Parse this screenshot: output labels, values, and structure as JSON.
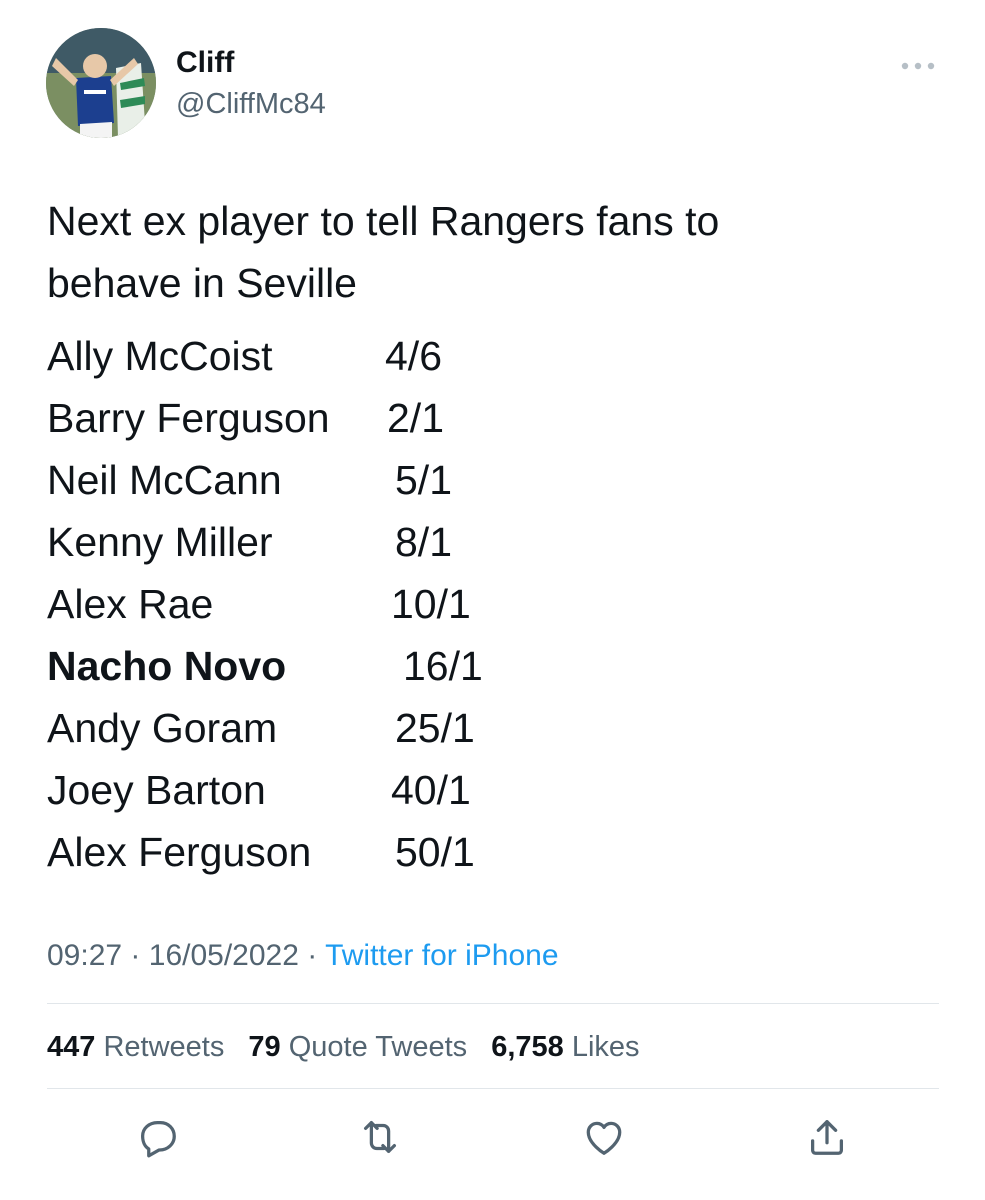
{
  "author": {
    "display_name": "Cliff",
    "handle": "@CliffMc84",
    "avatar_icon": "avatar-photo"
  },
  "tweet": {
    "text_line_1": "Next ex player to tell Rangers fans to",
    "text_line_2": "behave in Seville",
    "odds": [
      {
        "name": "Ally McCoist",
        "odds": "4/6",
        "bold": false
      },
      {
        "name": "Barry Ferguson",
        "odds": "2/1",
        "bold": false
      },
      {
        "name": "Neil McCann",
        "odds": "5/1",
        "bold": false
      },
      {
        "name": "Kenny Miller",
        "odds": "8/1",
        "bold": false
      },
      {
        "name": "Alex Rae",
        "odds": "10/1",
        "bold": false
      },
      {
        "name": "Nacho Novo",
        "odds": "16/1",
        "bold": true
      },
      {
        "name": "Andy Goram",
        "odds": "25/1",
        "bold": false
      },
      {
        "name": "Joey Barton",
        "odds": "40/1",
        "bold": false
      },
      {
        "name": "Alex Ferguson",
        "odds": "50/1",
        "bold": false
      }
    ]
  },
  "meta": {
    "time": "09:27",
    "separator": "·",
    "date": "16/05/2022",
    "source": "Twitter for iPhone"
  },
  "stats": {
    "retweets_count": "447",
    "retweets_label": "Retweets",
    "quotes_count": "79",
    "quotes_label": "Quote Tweets",
    "likes_count": "6,758",
    "likes_label": "Likes"
  },
  "actions": [
    "reply-icon",
    "retweet-icon",
    "like-icon",
    "share-icon"
  ],
  "colors": {
    "text": "#0f1419",
    "secondary": "#536471",
    "link": "#1d9bf0",
    "divider": "#e1e6ea"
  }
}
